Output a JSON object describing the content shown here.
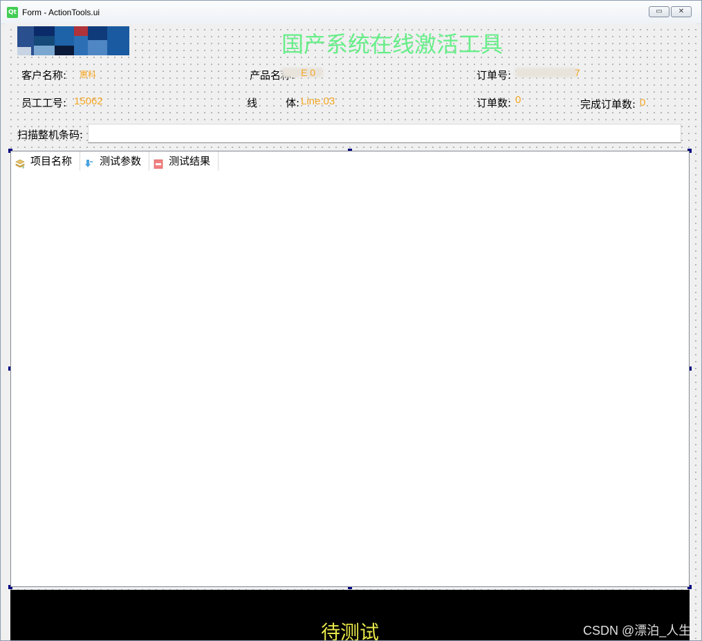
{
  "window": {
    "title": "Form - ActionTools.ui",
    "app_icon": "Qt"
  },
  "header": {
    "title": "国产系统在线激活工具"
  },
  "info": {
    "customer_label": "客户名称:",
    "customer_value": "惠科",
    "product_label": "产品名称:",
    "product_value": "E    0",
    "order_no_label": "订单号:",
    "order_no_value": "7",
    "employee_label": "员工工号:",
    "employee_value": "15062",
    "line_label_1": "线",
    "line_label_2": "体:",
    "line_value": "Line.03",
    "order_count_label": "订单数:",
    "order_count_value": "0",
    "done_count_label": "完成订单数:",
    "done_count_value": "0"
  },
  "scan": {
    "label": "扫描整机条码:",
    "value": ""
  },
  "tree": {
    "columns": [
      {
        "label": "项目名称",
        "icon": "layers-icon"
      },
      {
        "label": "测试参数",
        "icon": "download-arrow-icon"
      },
      {
        "label": "测试结果",
        "icon": "document-icon"
      }
    ]
  },
  "status": {
    "text": "待测试"
  },
  "watermark": "CSDN @漂泊_人生",
  "colors": {
    "title": "#66ee88",
    "value": "#f5a623",
    "status_bg": "#000000",
    "status_text": "#e8e84a"
  }
}
